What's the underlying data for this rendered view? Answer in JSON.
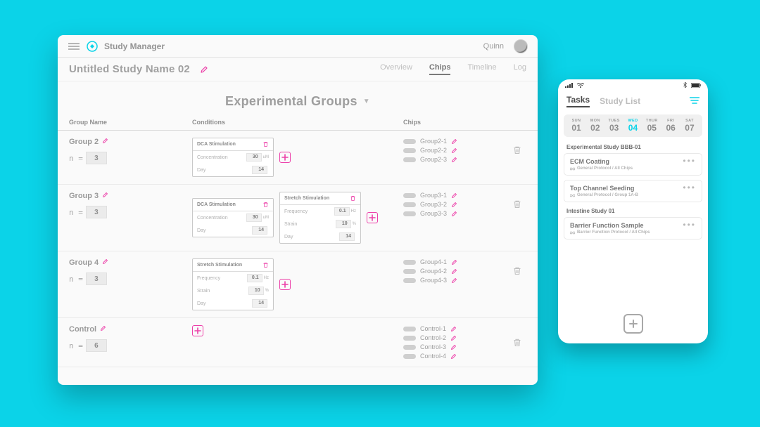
{
  "header": {
    "app_name": "Study Manager",
    "user_name": "Quinn"
  },
  "study": {
    "title": "Untitled Study Name 02",
    "tabs": {
      "overview": "Overview",
      "chips": "Chips",
      "timeline": "Timeline",
      "log": "Log"
    },
    "active_tab": "chips"
  },
  "page": {
    "title": "Experimental Groups",
    "columns": {
      "name": "Group Name",
      "conditions": "Conditions",
      "chips": "Chips"
    },
    "n_prefix": "n ="
  },
  "groups": [
    {
      "name": "Group 2",
      "n": "3",
      "conditions": [
        {
          "title": "DCA Stimulation",
          "fields": [
            {
              "label": "Concentration",
              "value": "30",
              "unit": "uM"
            },
            {
              "label": "Day",
              "value": "14",
              "unit": ""
            }
          ]
        }
      ],
      "chips": [
        "Group2-1",
        "Group2-2",
        "Group2-3"
      ]
    },
    {
      "name": "Group 3",
      "n": "3",
      "conditions": [
        {
          "title": "DCA Stimulation",
          "fields": [
            {
              "label": "Concentration",
              "value": "30",
              "unit": "uM"
            },
            {
              "label": "Day",
              "value": "14",
              "unit": ""
            }
          ]
        },
        {
          "title": "Stretch Stimulation",
          "fields": [
            {
              "label": "Frequency",
              "value": "0.1",
              "unit": "Hz"
            },
            {
              "label": "Strain",
              "value": "10",
              "unit": "%"
            },
            {
              "label": "Day",
              "value": "14",
              "unit": ""
            }
          ]
        }
      ],
      "chips": [
        "Group3-1",
        "Group3-2",
        "Group3-3"
      ]
    },
    {
      "name": "Group 4",
      "n": "3",
      "conditions": [
        {
          "title": "Stretch Stimulation",
          "fields": [
            {
              "label": "Frequency",
              "value": "0.1",
              "unit": "Hz"
            },
            {
              "label": "Strain",
              "value": "10",
              "unit": "%"
            },
            {
              "label": "Day",
              "value": "14",
              "unit": ""
            }
          ]
        }
      ],
      "chips": [
        "Group4-1",
        "Group4-2",
        "Group4-3"
      ]
    },
    {
      "name": "Control",
      "n": "6",
      "conditions": [],
      "chips": [
        "Control-1",
        "Control-2",
        "Control-3",
        "Control-4"
      ]
    }
  ],
  "mobile": {
    "tabs": {
      "tasks": "Tasks",
      "study_list": "Study List"
    },
    "calendar": [
      {
        "dow": "SUN",
        "num": "01",
        "active": false
      },
      {
        "dow": "MON",
        "num": "02",
        "active": false
      },
      {
        "dow": "TUES",
        "num": "03",
        "active": false
      },
      {
        "dow": "WED",
        "num": "04",
        "active": true
      },
      {
        "dow": "THUR",
        "num": "05",
        "active": false
      },
      {
        "dow": "FRI",
        "num": "06",
        "active": false
      },
      {
        "dow": "SAT",
        "num": "07",
        "active": false
      }
    ],
    "sections": [
      {
        "title": "Experimental Study BBB-01",
        "tasks": [
          {
            "name": "ECM Coating",
            "meta": "General Protocol / All Chips"
          },
          {
            "name": "Top Channel Seeding",
            "meta": "General Protocol / Group 1A-B"
          }
        ]
      },
      {
        "title": "Intestine Study 01",
        "tasks": [
          {
            "name": "Barrier Function Sample",
            "meta": "Barrier Function Protocol / All Chips"
          }
        ]
      }
    ]
  }
}
